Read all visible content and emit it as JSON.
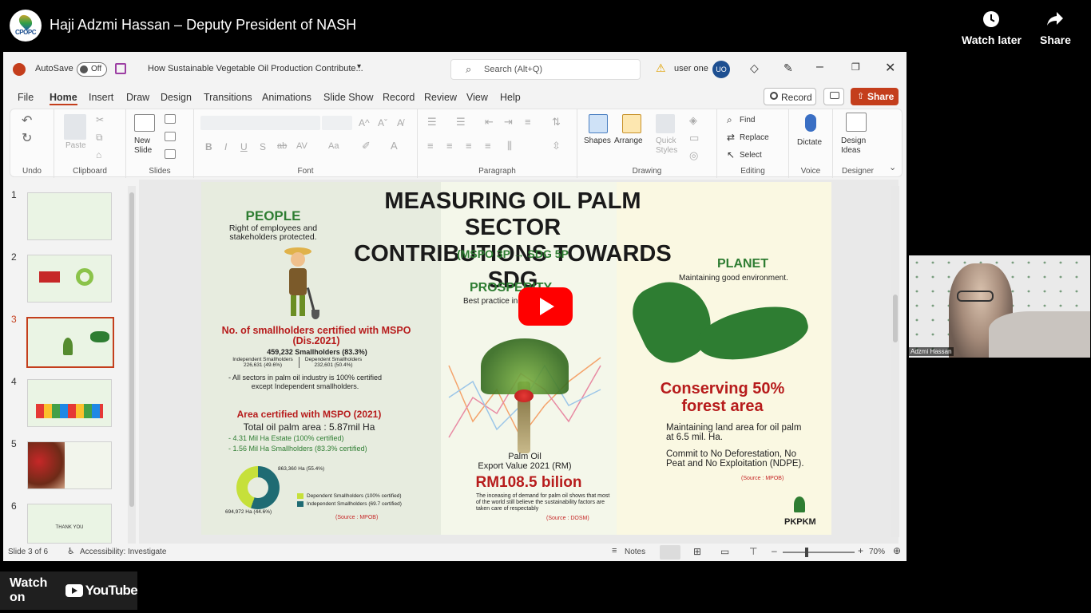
{
  "youtube": {
    "channel_logo_text": "CPOPC",
    "video_title": "Haji Adzmi Hassan – Deputy President of NASH",
    "watch_later": "Watch later",
    "share": "Share",
    "watch_on": "Watch on",
    "youtube_brand": "YouTube"
  },
  "ppt": {
    "autosave_label": "AutoSave",
    "autosave_state": "Off",
    "doc_title": "How Sustainable Vegetable Oil Production Contribute...",
    "search_placeholder": "Search (Alt+Q)",
    "user_name": "user one",
    "user_initials": "UO",
    "menu": [
      "File",
      "Home",
      "Insert",
      "Draw",
      "Design",
      "Transitions",
      "Animations",
      "Slide Show",
      "Record",
      "Review",
      "View",
      "Help"
    ],
    "active_menu": "Home",
    "record_btn": "Record",
    "share_btn": "Share",
    "ribbon_groups": {
      "undo": "Undo",
      "clipboard": "Clipboard",
      "slides": "Slides",
      "font": "Font",
      "paragraph": "Paragraph",
      "drawing": "Drawing",
      "editing": "Editing",
      "voice": "Voice",
      "designer": "Designer"
    },
    "ribbon_labels": {
      "paste": "Paste",
      "new_slide": "New\nSlide",
      "shapes": "Shapes",
      "arrange": "Arrange",
      "quick_styles": "Quick\nStyles",
      "find": "Find",
      "replace": "Replace",
      "select": "Select",
      "dictate": "Dictate",
      "design_ideas": "Design\nIdeas"
    },
    "thumb_numbers": [
      "1",
      "2",
      "3",
      "4",
      "5",
      "6"
    ],
    "thumb6_text": "THANK YOU",
    "status_slide": "Slide 3 of 6",
    "status_accessibility": "Accessibility: Investigate",
    "status_notes": "Notes",
    "status_zoom": "70%"
  },
  "slide": {
    "title_line1": "MEASURING OIL PALM SECTOR",
    "title_line2": "CONTRIBUTIONS TOWARDS SDG",
    "subtitle": "(MSPO 3P → SDG 5P",
    "people": {
      "heading": "PEOPLE",
      "desc": "Right of employees and stakeholders protected.",
      "sh_heading": "No. of smallholders certified with MSPO (Dis.2021)",
      "sh_total": "459,232 Smallholders (83.3%)",
      "indep_label": "Independent Smallholders",
      "indep_val": "226,631 (49.6%)",
      "dep_label": "Dependent Smallholders",
      "dep_val": "232,601 (50.4%)",
      "note": "- All sectors in palm oil industry is 100% certified except Independent smallholders.",
      "area_heading": "Area certified with MSPO (2021)",
      "area_total": "Total oil palm area : 5.87mil Ha",
      "estate": "- 4.31 Mil Ha Estate (100% certified)",
      "smallholders": "- 1.56 Mil Ha Smallholders (83.3% certified)",
      "pie_top": "863,360 Ha (55.4%)",
      "pie_bottom": "694,972 Ha (44.6%)",
      "legend_dep": "Dependent Smallholders (100% certified)",
      "legend_indep": "Independent Smallholders (69.7 certified)",
      "source": "(Source : MPOB)"
    },
    "prosperity": {
      "heading": "PROSPERITY",
      "desc": "Best practice in",
      "palm_oil": "Palm Oil",
      "export": "Export Value 2021 (RM)",
      "value": "RM108.5 bilion",
      "note": "The inceasing of demand for palm oil shows that most of the world still believe the sustainability factors are taken care of respectably",
      "source": "(Source : DOSM)"
    },
    "planet": {
      "heading": "PLANET",
      "desc": "Maintaining good environment.",
      "conserve1": "Conserving 50%",
      "conserve2": "forest area",
      "land": "Maintaining land area for oil palm at 6.5 mil. Ha.",
      "ndpe": "Commit to No Deforestation, No Peat and No Exploitation (NDPE).",
      "source": "(Source : MPOB)",
      "logo": "PKPKM"
    }
  },
  "camera": {
    "name_label": "Adzmi Hassan",
    "pattern_text": "PKPKM"
  },
  "colors": {
    "ppt_accent": "#c43e1c",
    "heading_green": "#2e7d32",
    "heading_red": "#b71c1c",
    "youtube_red": "#ff0000"
  }
}
